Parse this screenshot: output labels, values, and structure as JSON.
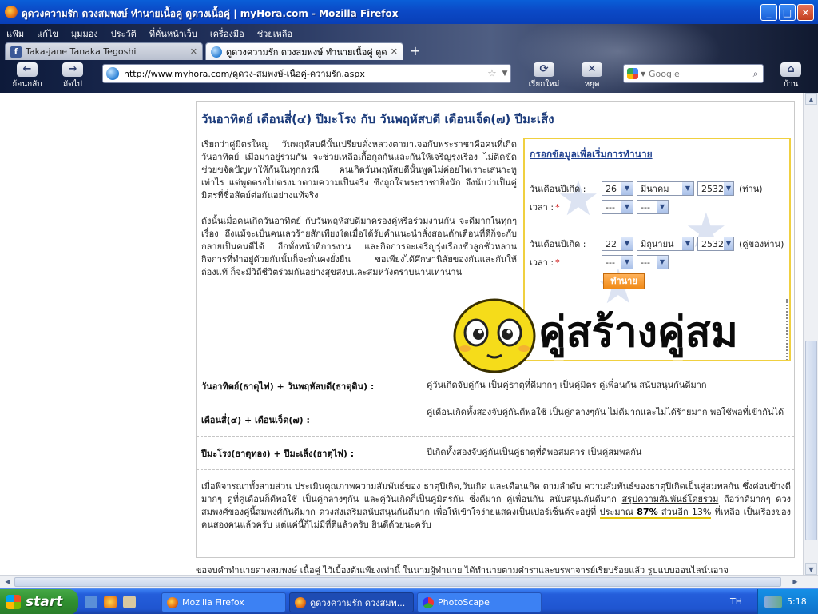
{
  "window": {
    "title": "ดูดวงความรัก ดวงสมพงษ์ ทำนายเนื้อคู่ ดูดวงเนื้อคู่ | myHora.com - Mozilla Firefox"
  },
  "menu": [
    "แฟ้ม",
    "แก้ไข",
    "มุมมอง",
    "ประวัติ",
    "ที่คั่นหน้าเว็บ",
    "เครื่องมือ",
    "ช่วยเหลือ"
  ],
  "tabs": [
    {
      "label": "Taka-jane Tanaka Tegoshi"
    },
    {
      "label": "ดูดวงความรัก ดวงสมพงษ์ ทำนายเนื้อคู่ ดูดว..."
    }
  ],
  "nav": {
    "back": "ย้อนกลับ",
    "forward": "ถัดไป",
    "reload": "เรียกใหม่",
    "stop": "หยุด",
    "home": "บ้าน",
    "url": "http://www.myhora.com/ดูดวง-สมพงษ์-เนื้อคู่-ความรัก.aspx",
    "search_placeholder": "Google"
  },
  "article": {
    "heading": "วันอาทิตย์ เดือนสี่(๔) ปีมะโรง กับ วันพฤหัสบดี เดือนเจ็ด(๗) ปีมะเส็ง",
    "para1": "เรียกว่าคู่มิตรใหญ่ วันพฤหัสบดีนั้นเปรียบดั่งหลวงตามาเจอกับพระราชาคือคนที่เกิดวันอาทิตย์ เมื่อมาอยู่ร่วมกัน จะช่วยเหลือเกื้อกูลกันและกันให้เจริญรุ่งเรือง ไม่ติดขัด ช่วยขจัดปัญหาให้กันในทุกกรณี คนเกิดวันพฤหัสบดีนั้นพูดไม่ค่อยไพเราะเสนาะหูเท่าไร แต่พูดตรงไปตรงมาตามความเป็นจริง ซึ่งถูกใจพระราชายิ่งนัก จึงนับว่าเป็นคู่มิตรที่ซื่อสัตย์ต่อกันอย่างแท้จริง",
    "para2": "ดังนั้นเมื่อคนเกิดวันอาทิตย์ กับวันพฤหัสบดีมาครองคู่หรือร่วมงานกัน จะดีมากในทุกๆเรื่อง ถึงแม้จะเป็นคนเลวร้ายสักเพียงใดเมื่อได้รับคำแนะนำสั่งสอนตักเตือนที่ดีก็จะกับกลายเป็นคนดีได้ อีกทั้งหน้าที่การงาน และกิจการจะเจริญรุ่งเรืองชั่วลูกชั่วหลาน กิจการที่ทำอยู่ด้วยกันนั้นก็จะมั่นคงยั่งยืน ขอเพียงได้ศึกษานิสัยของกันและกันให้ถ่องแท้ ก็จะมีวิถีชีวิตร่วมกันอย่างสุขสงบและสมหวังตราบนานเท่านาน"
  },
  "form": {
    "title": "กรอกข้อมูลเพื่อเริ่มการทำนาย",
    "birth_label": "วันเดือนปีเกิด :",
    "time_label": "เวลา :",
    "person1": {
      "day": "26",
      "month": "มีนาคม",
      "year": "2532",
      "suffix": "(ท่าน)",
      "hour": "---",
      "minute": "---"
    },
    "person2": {
      "day": "22",
      "month": "มิถุนายน",
      "year": "2532",
      "suffix": "(คู่ของท่าน)",
      "hour": "---",
      "minute": "---"
    },
    "submit": "ทำนาย",
    "required_mark": "*"
  },
  "banner": {
    "text": "คู่สร้างคู่สม"
  },
  "compat": [
    {
      "factor": "วันอาทิตย์(ธาตุไฟ) + วันพฤหัสบดี(ธาตุดิน) :",
      "result": "คู่วันเกิดจับคู่กัน เป็นคู่ธาตุที่ดีมากๆ เป็นคู่มิตร คู่เพื่อนกัน สนับสนุนกันดีมาก"
    },
    {
      "factor": "เดือนสี่(๔) + เดือนเจ็ด(๗) :",
      "result": "คู่เดือนเกิดทั้งสองจับคู่กันดีพอใช้ เป็นคู่กลางๆกัน ไม่ดีมากและไม่ได้ร้ายมาก พอใช้พอที่เข้ากันได้"
    },
    {
      "factor": "ปีมะโรง(ธาตุทอง) + ปีมะเส็ง(ธาตุไฟ) :",
      "result": "ปีเกิดทั้งสองจับคู่กันเป็นคู่ธาตุที่ดีพอสมควร เป็นคู่สมพลกัน"
    }
  ],
  "summary": {
    "part1": "เมื่อพิจารณาทั้งสามส่วน ประเมินคุณภาพความสัมพันธ์ของ ธาตุปีเกิด,วันเกิด และเดือนเกิด ตามลำดับ ความสัมพันธ์ของธาตุปีเกิดเป็นคู่สมพลกัน ซึ่งค่อนข้างดีมากๆ ดูที่คู่เดือนก็ดีพอใช้ เป็นคู่กลางๆกัน และคู่วันเกิดก็เป็นคู่มิตรกัน ซึ่งดีมาก คู่เพื่อนกัน สนับสนุนกันดีมาก ",
    "link": "สรุปความสัมพันธ์โดยรวม",
    "part2": " ถือว่าดีมากๆ ดวงสมพงศ์ของคู่นี้สมพงศ์กันดีมาก ดวงส่งเสริมสนับสนุนกันดีมาก เพื่อให้เข้าใจง่ายแสดงเป็นเปอร์เซ็นต์จะอยู่ที่ ",
    "percent_prefix": "ประมาณ ",
    "percent": "87%",
    "percent_rest": " ส่วนอีก 13%",
    "part3": " ที่เหลือ เป็นเรื่องของคนสองคนแล้วครับ แต่แค่นี้ก็ไม่มีที่ติแล้วครับ ยินดีด้วยนะครับ"
  },
  "footer": "ขอจบคำทำนายดวงสมพงษ์ เนื้อคู่ ไว้เบื้องต้นเพียงเท่านี้ ในนามผู้ทำนาย ได้ทำนายตามตำราและบรพาจารย์เรียบร้อยแล้ว รูปแบบออนไลน์นอาจ",
  "taskbar": {
    "start": "start",
    "tasks": [
      "Mozilla Firefox",
      "ดูดวงความรัก ดวงสมพ...",
      "PhotoScape"
    ],
    "lang": "TH",
    "time": "5:18"
  },
  "colors": {
    "accent": "#1a3a7a",
    "form_border": "#f0d040",
    "button": "#f08a18",
    "taskbar": "#245edb",
    "start": "#2f8f2f"
  }
}
